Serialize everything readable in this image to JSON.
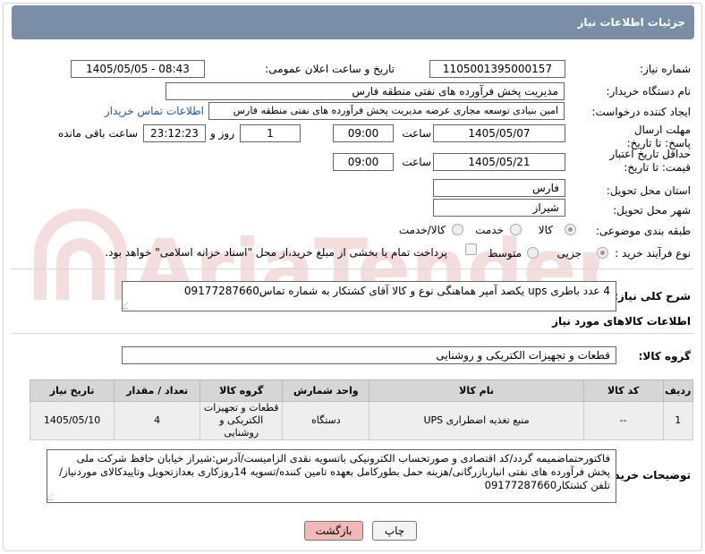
{
  "header": {
    "title": "جزئیات اطلاعات نیاز"
  },
  "form": {
    "need_number_label": "شماره نیاز:",
    "need_number": "1105001395000157",
    "announce_label": "تاریخ و ساعت اعلان عمومی:",
    "announce_value": "1405/05/05 - 08:43",
    "buyer_org_label": "نام دستگاه خریدار:",
    "buyer_org": "مدیریت پخش فرآورده های نفتی منطقه فارس",
    "requester_label": "ایجاد کننده درخواست:",
    "requester": "امین بنیادی توسعه مجاری عرضه مدیریت پخش فرآورده های نفتی منطقه فارس",
    "buyer_contact_link": "اطلاعات تماس خریدار",
    "send_deadline_label": "مهلت ارسال پاسخ: تا تاریخ:",
    "send_date": "1405/05/07",
    "time_label": "ساعت",
    "send_time": "09:00",
    "days_value": "1",
    "days_label": "روز و",
    "remaining_time": "23:12:23",
    "remaining_label": "ساعت باقی مانده",
    "price_validity_label": "حداقل تاریخ اعتبار قیمت: تا تاریخ:",
    "validity_date": "1405/05/21",
    "validity_time": "09:00",
    "province_label": "استان محل تحویل:",
    "province": "فارس",
    "city_label": "شهر محل تحویل:",
    "city": "شیراز",
    "category_label": "طبقه بندی موضوعی:",
    "category_options": [
      "کالا",
      "خدمت",
      "کالا/خدمت"
    ],
    "process_label": "نوع فرآیند خرید :",
    "process_options": [
      "جزیی",
      "متوسط"
    ],
    "payment_note": "پرداخت تمام یا بخشی از مبلغ خرید،از محل \"اسناد خزانه اسلامی\" خواهد بود."
  },
  "description": {
    "label": "شرح کلی نیاز:",
    "text": "4 عدد باطری ups یکصد آمپر هماهنگی نوع و کالا آقای کشتکار به شماره تماس09177287660"
  },
  "goods": {
    "section_title": "اطلاعات کالاهای مورد نیاز",
    "group_label": "گروه کالا:",
    "group_value": "قطعات و تجهیزات الکتریکی و روشنایی",
    "columns": [
      "ردیف",
      "کد کالا",
      "نام کالا",
      "واحد شمارش",
      "گروه کالا",
      "تعداد / مقدار",
      "تاریخ نیاز"
    ],
    "rows": [
      {
        "index": "1",
        "code": "--",
        "name": "منبع تغذیه اضطراری UPS",
        "unit": "دستگاه",
        "group": "قطعات و تجهیزات الکتریکی و روشنایی",
        "qty": "4",
        "date": "1405/05/10"
      }
    ]
  },
  "buyer_notes": {
    "label": "توضیحات خریدار:",
    "text": "فاکتورحتماضمیمه گردد/کد اقتصادی و صورتحساب الکترونیکی باتسویه نقدی الزامیست/آدرس:شیراز خیابان حافظ شرکت ملی پخش فرآورده های نفتی انباربازرگانی/هزینه حمل بطورکامل بعهده تامین کننده/تسویه 14روزکاری بعدازتحویل وتاییدکالای موردنیاز/تلفن کشتکار09177287660"
  },
  "buttons": {
    "back": "بازگشت",
    "print": "چاپ"
  },
  "watermark": {
    "text": "AriaTender.net"
  },
  "colors": {
    "titlebar": "#7a8ea8",
    "back_button": "#f2b8b8",
    "link": "#1a55b8"
  }
}
